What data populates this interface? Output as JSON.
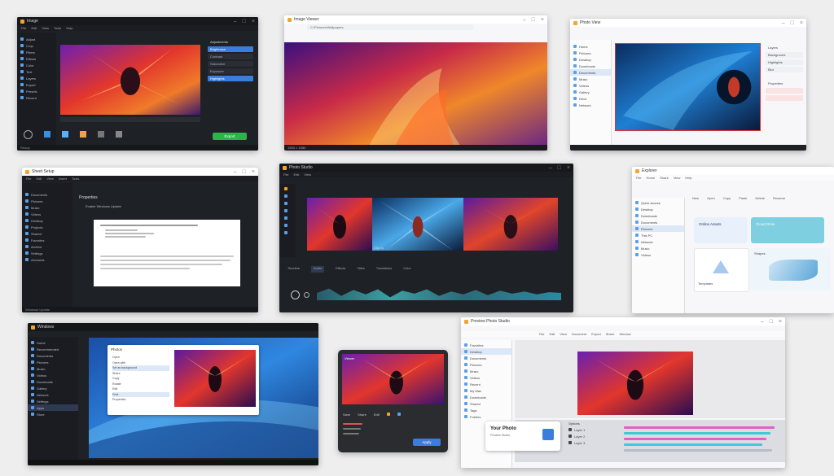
{
  "window1": {
    "title": "Image",
    "menu": [
      "File",
      "Edit",
      "View",
      "Tools",
      "Help"
    ],
    "sidebar": [
      "Adjust",
      "Crop",
      "Filters",
      "Effects",
      "Color",
      "Text",
      "Layers",
      "Export",
      "Presets",
      "Recent"
    ],
    "panel_title": "Adjustments",
    "panel_rows": [
      "Brightness",
      "Contrast",
      "Saturation",
      "Exposure",
      "Highlights"
    ],
    "action_button": "Export",
    "status": "Ready"
  },
  "window2": {
    "title": "Image Viewer",
    "path": "C:\\Pictures\\Wallpapers",
    "status": "1920 × 1080"
  },
  "window3": {
    "title": "Photo View",
    "panel_title": "Layers",
    "panel_rows": [
      "Background",
      "Highlights",
      "Blur"
    ],
    "panel2_title": "Properties",
    "sidebar": [
      "Home",
      "Pictures",
      "Desktop",
      "Downloads",
      "Documents",
      "Music",
      "Videos",
      "Gallery",
      "Drive",
      "Network"
    ]
  },
  "window4": {
    "title": "Sheet Setup",
    "menu": [
      "File",
      "Edit",
      "View",
      "Insert",
      "Tools"
    ],
    "sidebar": [
      "Documents",
      "Pictures",
      "Music",
      "Videos",
      "Desktop",
      "Projects",
      "Shared",
      "Favorites",
      "Archive",
      "Settings",
      "Accounts"
    ],
    "section": "Properties",
    "option": "Enable Windows Update",
    "footer": "Windows Update"
  },
  "window5": {
    "title": "Photo Studio",
    "menu": [
      "File",
      "Edit",
      "View"
    ],
    "tabs": [
      "Timeline",
      "Audio",
      "Effects",
      "Titles",
      "Transitions",
      "Color"
    ],
    "clip_label": "Clip 01"
  },
  "window6": {
    "title": "Explorer",
    "menu": [
      "File",
      "Home",
      "Share",
      "View",
      "Help"
    ],
    "ribbon": [
      "New",
      "Open",
      "Copy",
      "Paste",
      "Delete",
      "Rename"
    ],
    "sidebar": [
      "Quick access",
      "Desktop",
      "Downloads",
      "Documents",
      "Pictures",
      "This PC",
      "Network",
      "Music",
      "Videos"
    ],
    "tiles": [
      "Online Assets",
      "Cloud Drive",
      "Templates",
      "Shapes"
    ]
  },
  "window7": {
    "title": "Windows",
    "sidebar": [
      "Home",
      "Recommended",
      "Documents",
      "Pictures",
      "Music",
      "Videos",
      "Downloads",
      "Gallery",
      "Network",
      "Settings",
      "Apps",
      "Store"
    ],
    "dialog_title": "Photos",
    "dialog_options": [
      "Open",
      "Open with",
      "Set as background",
      "Share",
      "Copy",
      "Rotate",
      "Edit",
      "Print",
      "Properties"
    ]
  },
  "window8": {
    "title": "Viewer",
    "buttons": [
      "Save",
      "Share",
      "Edit"
    ],
    "action_button": "Apply"
  },
  "window9": {
    "title": "Preview Photo Studio",
    "menu": [
      "File",
      "Edit",
      "View",
      "Document",
      "Export",
      "Share",
      "Window"
    ],
    "sidebar": [
      "Favorites",
      "Desktop",
      "Documents",
      "Pictures",
      "Music",
      "Videos",
      "Recent",
      "My Mac",
      "Downloads",
      "Shared",
      "Tags",
      "Folders"
    ],
    "popup_title": "Your Photo",
    "popup_sub": "Preview Studio",
    "panel_title": "Options",
    "panel_rows": [
      "Layer 1",
      "Layer 2",
      "Layer 3"
    ]
  },
  "colors": {
    "accent_green": "#2db34a",
    "accent_blue": "#3b7ddd",
    "accent_red": "#e0303a",
    "pink_bar": "#e35fc7",
    "cyan_bar": "#40c8d8"
  }
}
